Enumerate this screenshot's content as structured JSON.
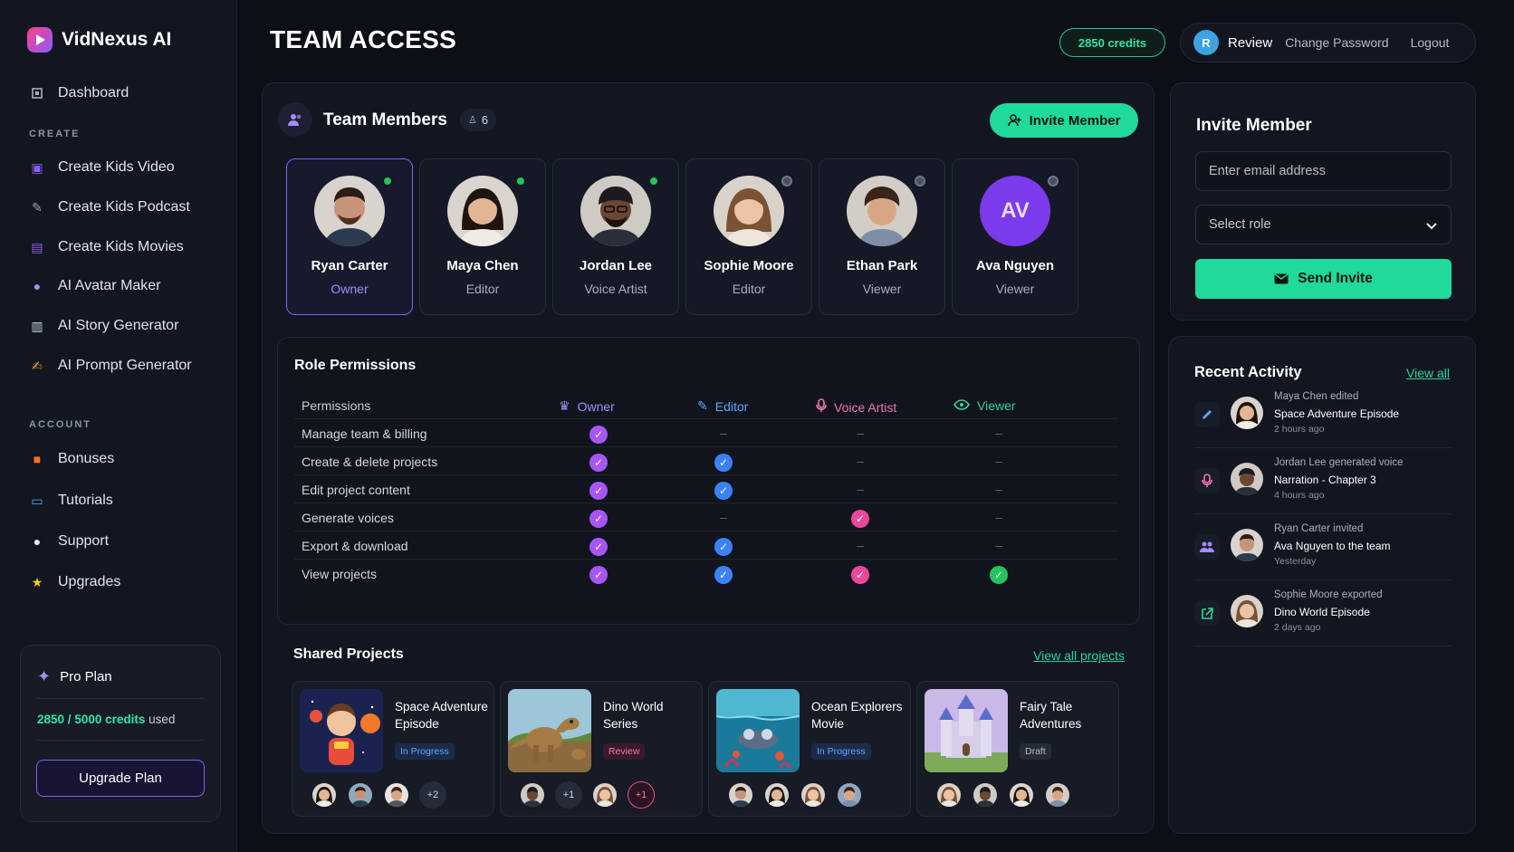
{
  "app": {
    "name": "VidNexus AI"
  },
  "page": {
    "title": "TEAM ACCESS"
  },
  "header": {
    "credits": "2850 credits",
    "user_initial": "R",
    "user_name": "Review",
    "change_password": "Change Password",
    "logout": "Logout"
  },
  "sidebar": {
    "dashboard": "Dashboard",
    "create_label": "CREATE",
    "create_items": [
      "Create Kids Video",
      "Create Kids Podcast",
      "Create Kids Movies",
      "AI Avatar Maker",
      "AI Story Generator",
      "AI Prompt Generator"
    ],
    "account_label": "ACCOUNT",
    "account_items": [
      "Bonuses",
      "Tutorials",
      "Support",
      "Upgrades"
    ],
    "plan": {
      "name": "Pro Plan",
      "used": "2850",
      "total": "5000",
      "credits_word": "credits",
      "used_word": "used",
      "upgrade_label": "Upgrade Plan"
    }
  },
  "team": {
    "title": "Team Members",
    "count": "6",
    "invite_button": "Invite Member",
    "members": [
      {
        "name": "Ryan Carter",
        "role": "Owner",
        "online": true
      },
      {
        "name": "Maya Chen",
        "role": "Editor",
        "online": true
      },
      {
        "name": "Jordan Lee",
        "role": "Voice Artist",
        "online": true
      },
      {
        "name": "Sophie Moore",
        "role": "Editor",
        "online": false
      },
      {
        "name": "Ethan Park",
        "role": "Viewer",
        "online": false
      },
      {
        "name": "Ava Nguyen",
        "role": "Viewer",
        "online": false,
        "initials": "AV"
      }
    ]
  },
  "permissions": {
    "title": "Role Permissions",
    "header_first": "Permissions",
    "roles": [
      "Owner",
      "Editor",
      "Voice Artist",
      "Viewer"
    ],
    "dash": "–",
    "rows": [
      {
        "label": "Manage team & billing",
        "grants": [
          true,
          false,
          false,
          false
        ]
      },
      {
        "label": "Create & delete projects",
        "grants": [
          true,
          true,
          false,
          false
        ]
      },
      {
        "label": "Edit project content",
        "grants": [
          true,
          true,
          false,
          false
        ]
      },
      {
        "label": "Generate voices",
        "grants": [
          true,
          false,
          true,
          false
        ]
      },
      {
        "label": "Export & download",
        "grants": [
          true,
          true,
          false,
          false
        ]
      },
      {
        "label": "View projects",
        "grants": [
          true,
          true,
          true,
          true
        ]
      }
    ],
    "colors": {
      "owner": "#a855f7",
      "editor": "#3b82f6",
      "voice": "#ec4899",
      "viewer": "#22c55e"
    }
  },
  "projects": {
    "title": "Shared Projects",
    "view_all": "View all projects",
    "items": [
      {
        "name": "Space Adventure Episode",
        "status": "In Progress",
        "more": "+2"
      },
      {
        "name": "Dino World Series",
        "status": "Review",
        "more": "+1",
        "more2": "+1"
      },
      {
        "name": "Ocean Explorers Movie",
        "status": "In Progress"
      },
      {
        "name": "Fairy Tale Adventures",
        "status": "Draft"
      }
    ]
  },
  "invite": {
    "title": "Invite Member",
    "email_placeholder": "Enter email address",
    "role_placeholder": "Select role",
    "send_label": "Send Invite"
  },
  "activity": {
    "title": "Recent Activity",
    "view_all": "View all",
    "items": [
      {
        "line1": "Maya Chen edited",
        "line2": "Space Adventure Episode",
        "time": "2 hours ago",
        "icon": "pencil-icon"
      },
      {
        "line1": "Jordan Lee generated voice",
        "line2": "Narration - Chapter 3",
        "time": "4 hours ago",
        "icon": "microphone-icon"
      },
      {
        "line1": "Ryan Carter invited",
        "line2": "Ava Nguyen to the team",
        "time": "Yesterday",
        "icon": "users-icon"
      },
      {
        "line1": "Sophie Moore exported",
        "line2": "Dino World Episode",
        "time": "2 days ago",
        "icon": "export-icon"
      }
    ]
  }
}
